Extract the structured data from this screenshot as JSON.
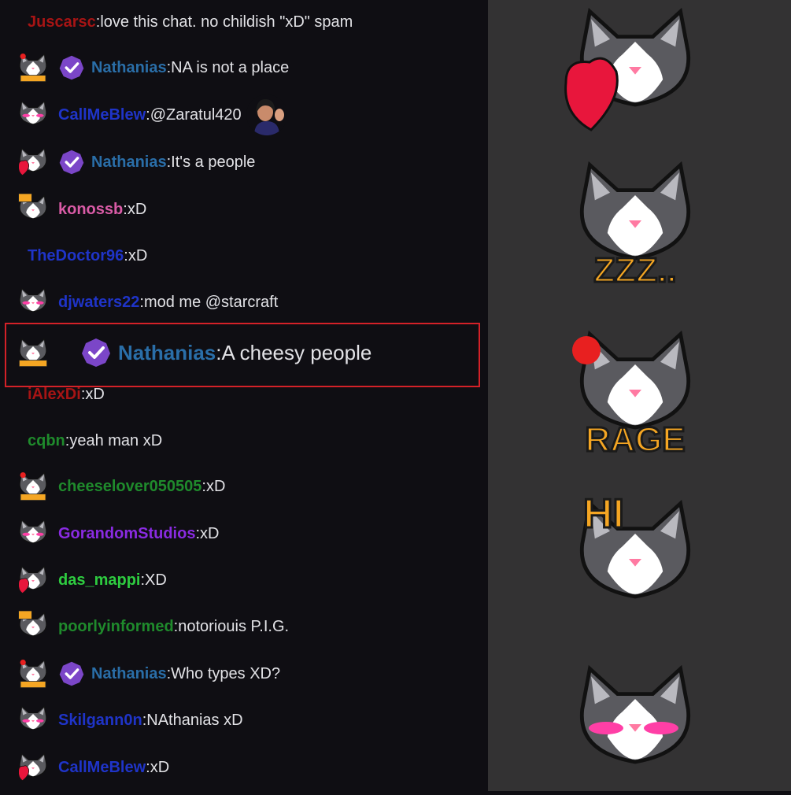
{
  "chat": {
    "messages": [
      {
        "user": "Juscarsc",
        "color": "#a61414",
        "text": "love this chat. no childish \"xD\" spam",
        "emote": "none",
        "badge": false
      },
      {
        "user": "Nathanias",
        "color": "#2a6ea8",
        "text": "NA is not a place",
        "emote": "rage",
        "badge": true
      },
      {
        "user": "CallMeBlew",
        "color": "#1f34c8",
        "text": "@Zaratul420",
        "emote": "blush",
        "badge": false,
        "avatar": true
      },
      {
        "user": "Nathanias",
        "color": "#2a6ea8",
        "text": "It's a people",
        "emote": "heart",
        "badge": true
      },
      {
        "user": "konossb",
        "color": "#d95ba6",
        "text": "xD",
        "emote": "hi",
        "badge": false
      },
      {
        "user": "TheDoctor96",
        "color": "#1f34c8",
        "text": "xD",
        "emote": "none",
        "badge": false
      },
      {
        "user": "djwaters22",
        "color": "#1f34c8",
        "text": "mod me @starcraft",
        "emote": "blush",
        "badge": false
      },
      {
        "user": "Nathanias",
        "color": "#2a6ea8",
        "text": "A cheesy people",
        "emote": "zzz",
        "badge": true,
        "highlight": true
      },
      {
        "user": "iAlexDi",
        "color": "#a61414",
        "text": "xD",
        "emote": "none",
        "badge": false
      },
      {
        "user": "cqbn",
        "color": "#1f8a2c",
        "text": "yeah man xD",
        "emote": "none",
        "badge": false
      },
      {
        "user": "cheeselover050505",
        "color": "#1f8a2c",
        "text": "xD",
        "emote": "rage",
        "badge": false
      },
      {
        "user": "GorandomStudios",
        "color": "#8a2be2",
        "text": "xD",
        "emote": "blush",
        "badge": false
      },
      {
        "user": "das_mappi",
        "color": "#2ecc40",
        "text": "XD",
        "emote": "heart",
        "badge": false
      },
      {
        "user": "poorlyinformed",
        "color": "#1f8a2c",
        "text": "notoriouis P.I.G.",
        "emote": "hi",
        "badge": false
      },
      {
        "user": "Nathanias",
        "color": "#2a6ea8",
        "text": "Who types XD?",
        "emote": "rage",
        "badge": true
      },
      {
        "user": "Skilgann0n",
        "color": "#1f34c8",
        "text": "NAthanias xD",
        "emote": "blush",
        "badge": false
      },
      {
        "user": "CallMeBlew",
        "color": "#1f34c8",
        "text": "xD",
        "emote": "heart",
        "badge": false
      }
    ]
  },
  "emote_panel": {
    "emotes": [
      {
        "name": "heart-cat",
        "caption": ""
      },
      {
        "name": "zzz-cat",
        "caption": "ZZZ.."
      },
      {
        "name": "rage-cat",
        "caption": "RAGE"
      },
      {
        "name": "hi-cat",
        "caption": "HI"
      },
      {
        "name": "blush-cat",
        "caption": ""
      }
    ]
  },
  "colors": {
    "highlight_border": "#d42128",
    "badge": "#7b46c8",
    "panel_bg": "#333233",
    "chat_bg": "#0f0e13",
    "caption_fill": "#f5a623"
  }
}
